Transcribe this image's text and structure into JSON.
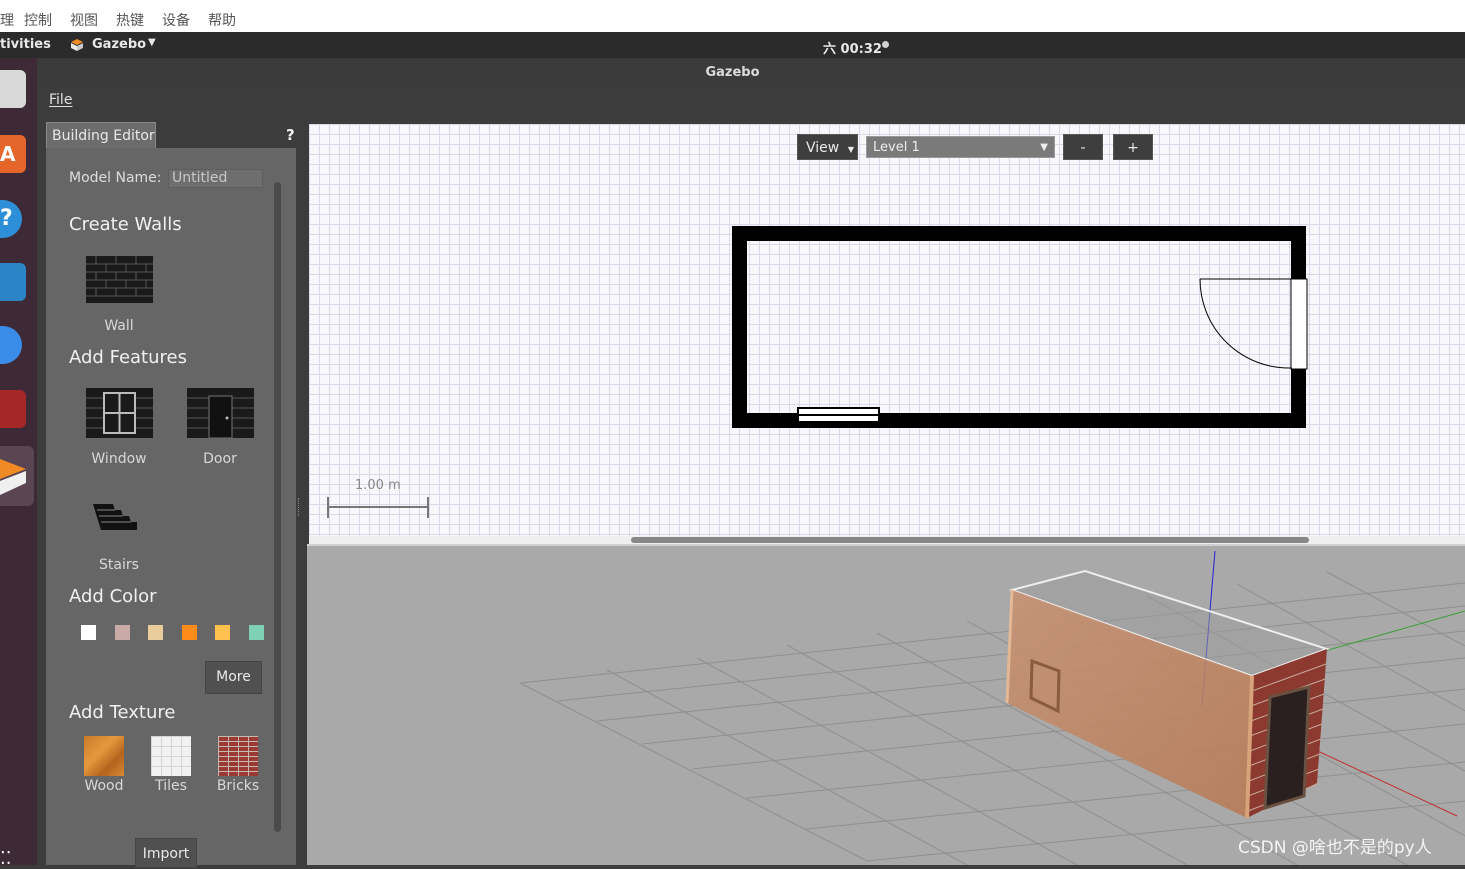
{
  "host_menu": [
    "理",
    "控制",
    "视图",
    "热键",
    "设备",
    "帮助"
  ],
  "top_panel": {
    "activities": "tivities",
    "app_name": "Gazebo",
    "clock": "六 00:32"
  },
  "window_title": "Gazebo",
  "app_menu": {
    "file": "File"
  },
  "editor": {
    "tab": "Building Editor",
    "help": "?",
    "model_name_label": "Model Name:",
    "model_name_value": "Untitled",
    "create_walls": "Create Walls",
    "wall": "Wall",
    "add_features": "Add Features",
    "window": "Window",
    "door": "Door",
    "stairs": "Stairs",
    "add_color": "Add Color",
    "colors": [
      "#ffffff",
      "#c9aaa6",
      "#e9cc9c",
      "#ff8c1a",
      "#ffc04d",
      "#7fd1b5"
    ],
    "more": "More",
    "add_texture": "Add Texture",
    "wood": "Wood",
    "tiles": "Tiles",
    "bricks": "Bricks",
    "import": "Import"
  },
  "view2d": {
    "view_btn": "View",
    "level": "Level 1",
    "minus": "-",
    "plus": "+",
    "scale": "1.00 m"
  },
  "watermark": "CSDN @啥也不是的py人"
}
